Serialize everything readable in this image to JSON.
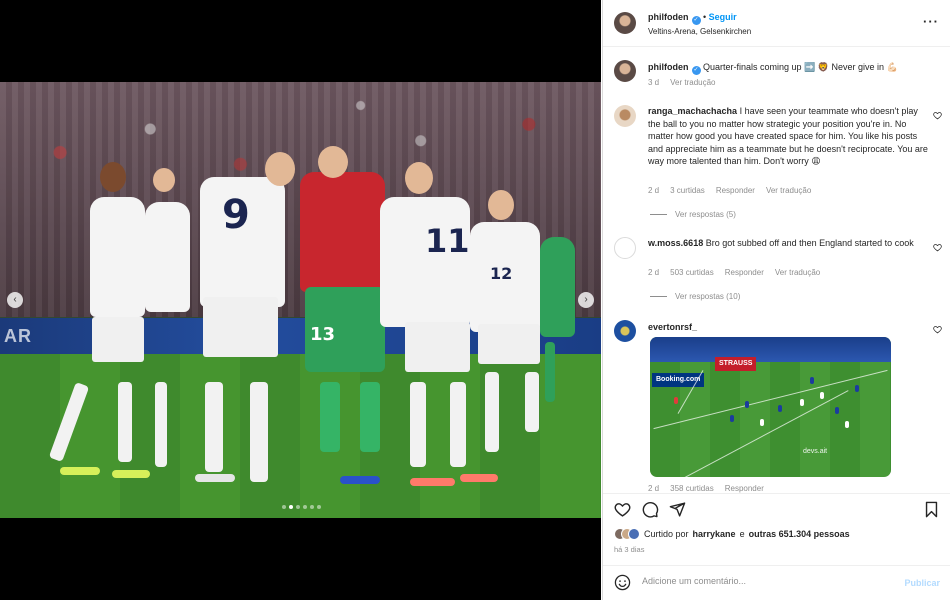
{
  "post": {
    "username": "philfoden",
    "follow_label": "Seguir",
    "location": "Veltins-Arena, Gelsenkirchen",
    "caption": {
      "username": "philfoden",
      "text": "Quarter-finals coming up ➡️ 🦁 Never give in 💪🏻",
      "time": "3 d",
      "translate": "Ver tradução"
    },
    "media": {
      "adboard_text": "AR",
      "jersey_numbers": [
        "9",
        "11",
        "12",
        "13"
      ],
      "carousel_dots": 6,
      "active_dot": 1
    }
  },
  "comments": [
    {
      "username": "ranga_machachacha",
      "text": "I have seen your teammate who doesn't play the ball to you no matter how strategic your position you're in. No matter how good you have created space for him. You like his posts and appreciate him as a teammate but he doesn't reciprocate. You are way more talented than him. Don't worry 😩",
      "time": "2 d",
      "likes": "3 curtidas",
      "reply": "Responder",
      "translate": "Ver tradução",
      "view_replies": "Ver respostas (5)"
    },
    {
      "username": "w.moss.6618",
      "text": "Bro got subbed off and then England started to cook",
      "time": "2 d",
      "likes": "503 curtidas",
      "reply": "Responder",
      "translate": "Ver tradução",
      "view_replies": "Ver respostas (10)"
    },
    {
      "username": "evertonrsf_",
      "media_ads": [
        "Booking.com",
        "STRAUSS"
      ],
      "media_watermark": "devs.ait",
      "time": "2 d",
      "likes": "358 curtidas",
      "reply": "Responder"
    }
  ],
  "likes_line": {
    "prefix": "Curtido por",
    "user": "harrykane",
    "middle": "e",
    "others": "outras 651.304 pessoas"
  },
  "date": "há 3 dias",
  "add_comment": {
    "placeholder": "Adicione um comentário...",
    "post_label": "Publicar"
  },
  "icons": {
    "more": "more-icon",
    "heart": "heart-icon",
    "comment": "comment-icon",
    "share": "share-icon",
    "save": "bookmark-icon",
    "emoji": "emoji-icon",
    "prev": "chevron-left-icon",
    "next": "chevron-right-icon"
  }
}
